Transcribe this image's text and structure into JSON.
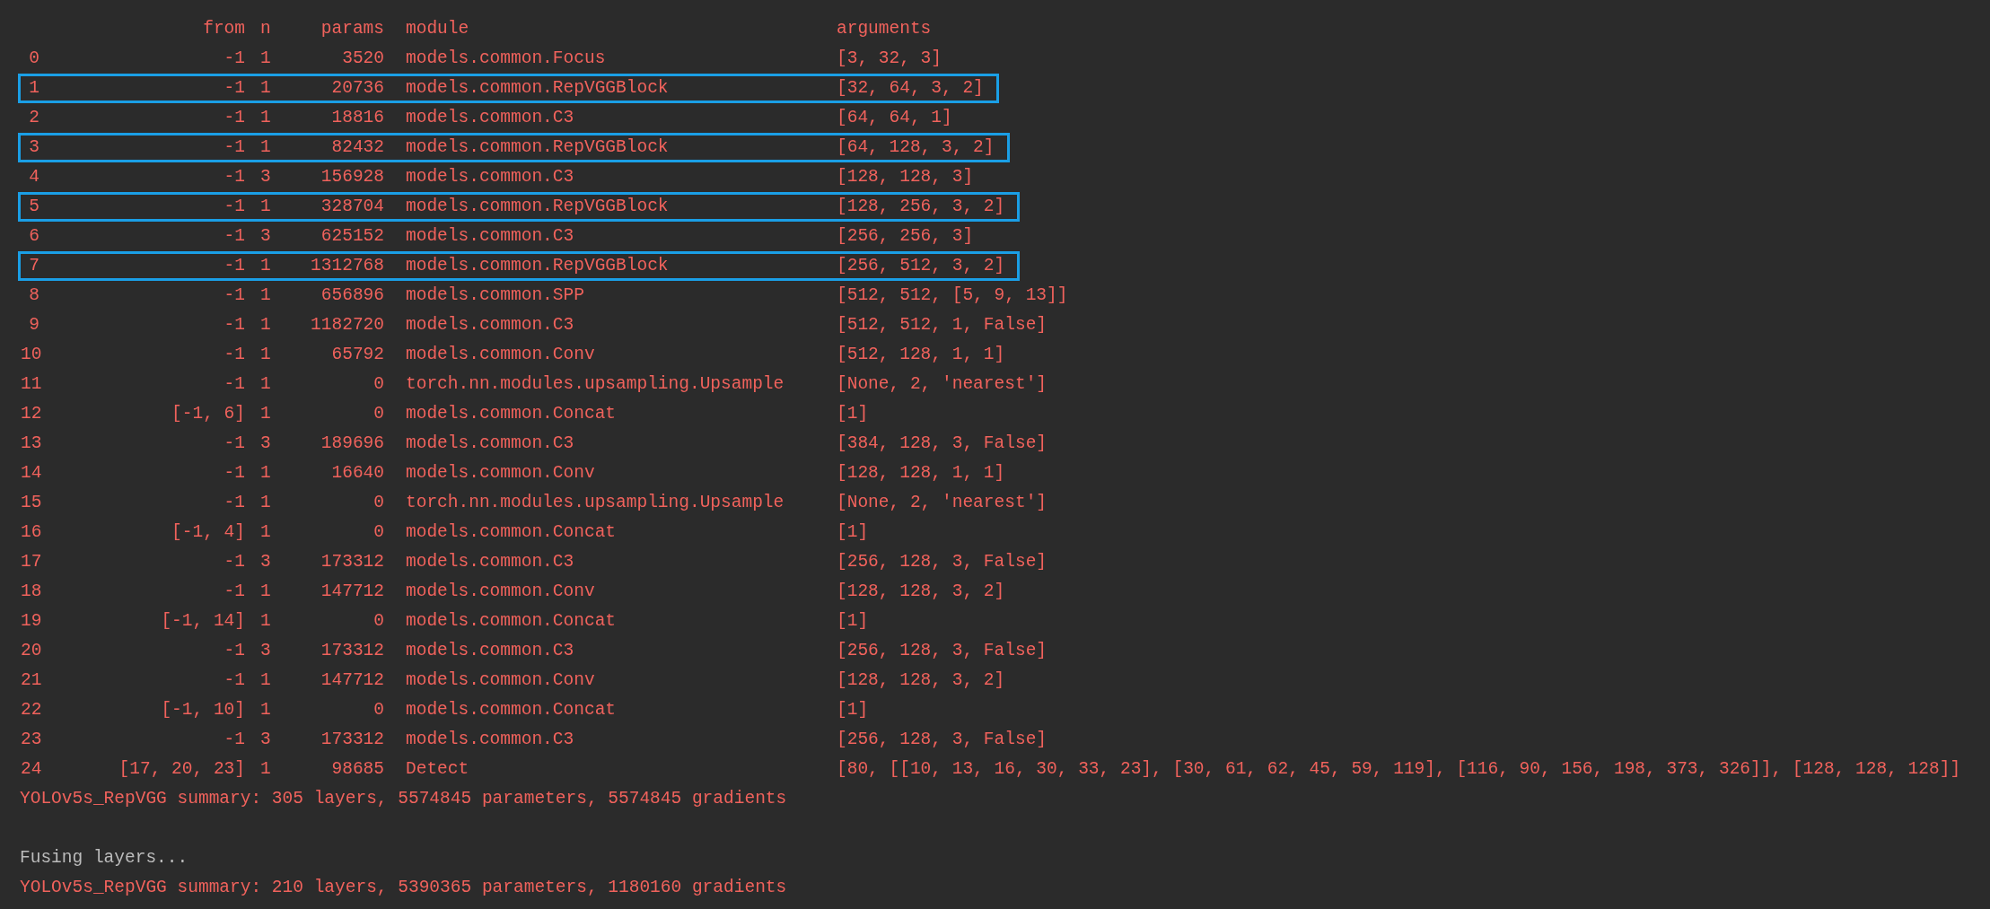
{
  "header": {
    "from": "from",
    "n": "n",
    "params": "params",
    "module": "module",
    "arguments": "arguments"
  },
  "rows": [
    {
      "index": "0",
      "from": "-1",
      "n": "1",
      "params": "3520",
      "module": "models.common.Focus",
      "arguments": "[3, 32, 3]",
      "highlighted": false
    },
    {
      "index": "1",
      "from": "-1",
      "n": "1",
      "params": "20736",
      "module": "models.common.RepVGGBlock",
      "arguments": "[32, 64, 3, 2]",
      "highlighted": true
    },
    {
      "index": "2",
      "from": "-1",
      "n": "1",
      "params": "18816",
      "module": "models.common.C3",
      "arguments": "[64, 64, 1]",
      "highlighted": false
    },
    {
      "index": "3",
      "from": "-1",
      "n": "1",
      "params": "82432",
      "module": "models.common.RepVGGBlock",
      "arguments": "[64, 128, 3, 2]",
      "highlighted": true
    },
    {
      "index": "4",
      "from": "-1",
      "n": "3",
      "params": "156928",
      "module": "models.common.C3",
      "arguments": "[128, 128, 3]",
      "highlighted": false
    },
    {
      "index": "5",
      "from": "-1",
      "n": "1",
      "params": "328704",
      "module": "models.common.RepVGGBlock",
      "arguments": "[128, 256, 3, 2]",
      "highlighted": true
    },
    {
      "index": "6",
      "from": "-1",
      "n": "3",
      "params": "625152",
      "module": "models.common.C3",
      "arguments": "[256, 256, 3]",
      "highlighted": false
    },
    {
      "index": "7",
      "from": "-1",
      "n": "1",
      "params": "1312768",
      "module": "models.common.RepVGGBlock",
      "arguments": "[256, 512, 3, 2]",
      "highlighted": true
    },
    {
      "index": "8",
      "from": "-1",
      "n": "1",
      "params": "656896",
      "module": "models.common.SPP",
      "arguments": "[512, 512, [5, 9, 13]]",
      "highlighted": false
    },
    {
      "index": "9",
      "from": "-1",
      "n": "1",
      "params": "1182720",
      "module": "models.common.C3",
      "arguments": "[512, 512, 1, False]",
      "highlighted": false
    },
    {
      "index": "10",
      "from": "-1",
      "n": "1",
      "params": "65792",
      "module": "models.common.Conv",
      "arguments": "[512, 128, 1, 1]",
      "highlighted": false
    },
    {
      "index": "11",
      "from": "-1",
      "n": "1",
      "params": "0",
      "module": "torch.nn.modules.upsampling.Upsample",
      "arguments": "[None, 2, 'nearest']",
      "highlighted": false
    },
    {
      "index": "12",
      "from": "[-1, 6]",
      "n": "1",
      "params": "0",
      "module": "models.common.Concat",
      "arguments": "[1]",
      "highlighted": false
    },
    {
      "index": "13",
      "from": "-1",
      "n": "3",
      "params": "189696",
      "module": "models.common.C3",
      "arguments": "[384, 128, 3, False]",
      "highlighted": false
    },
    {
      "index": "14",
      "from": "-1",
      "n": "1",
      "params": "16640",
      "module": "models.common.Conv",
      "arguments": "[128, 128, 1, 1]",
      "highlighted": false
    },
    {
      "index": "15",
      "from": "-1",
      "n": "1",
      "params": "0",
      "module": "torch.nn.modules.upsampling.Upsample",
      "arguments": "[None, 2, 'nearest']",
      "highlighted": false
    },
    {
      "index": "16",
      "from": "[-1, 4]",
      "n": "1",
      "params": "0",
      "module": "models.common.Concat",
      "arguments": "[1]",
      "highlighted": false
    },
    {
      "index": "17",
      "from": "-1",
      "n": "3",
      "params": "173312",
      "module": "models.common.C3",
      "arguments": "[256, 128, 3, False]",
      "highlighted": false
    },
    {
      "index": "18",
      "from": "-1",
      "n": "1",
      "params": "147712",
      "module": "models.common.Conv",
      "arguments": "[128, 128, 3, 2]",
      "highlighted": false
    },
    {
      "index": "19",
      "from": "[-1, 14]",
      "n": "1",
      "params": "0",
      "module": "models.common.Concat",
      "arguments": "[1]",
      "highlighted": false
    },
    {
      "index": "20",
      "from": "-1",
      "n": "3",
      "params": "173312",
      "module": "models.common.C3",
      "arguments": "[256, 128, 3, False]",
      "highlighted": false
    },
    {
      "index": "21",
      "from": "-1",
      "n": "1",
      "params": "147712",
      "module": "models.common.Conv",
      "arguments": "[128, 128, 3, 2]",
      "highlighted": false
    },
    {
      "index": "22",
      "from": "[-1, 10]",
      "n": "1",
      "params": "0",
      "module": "models.common.Concat",
      "arguments": "[1]",
      "highlighted": false
    },
    {
      "index": "23",
      "from": "-1",
      "n": "3",
      "params": "173312",
      "module": "models.common.C3",
      "arguments": "[256, 128, 3, False]",
      "highlighted": false
    },
    {
      "index": "24",
      "from": "[17, 20, 23]",
      "n": "1",
      "params": "98685",
      "module": "Detect",
      "arguments": "[80, [[10, 13, 16, 30, 33, 23], [30, 61, 62, 45, 59, 119], [116, 90, 156, 198, 373, 326]], [128, 128, 128]]",
      "highlighted": false
    }
  ],
  "log_lines": [
    {
      "kind": "summary",
      "text": "YOLOv5s_RepVGG summary: 305 layers, 5574845 parameters, 5574845 gradients"
    },
    {
      "kind": "blank"
    },
    {
      "kind": "info",
      "text": "Fusing layers..."
    },
    {
      "kind": "summary",
      "text": "YOLOv5s_RepVGG summary: 210 layers, 5390365 parameters, 1180160 gradients"
    }
  ]
}
